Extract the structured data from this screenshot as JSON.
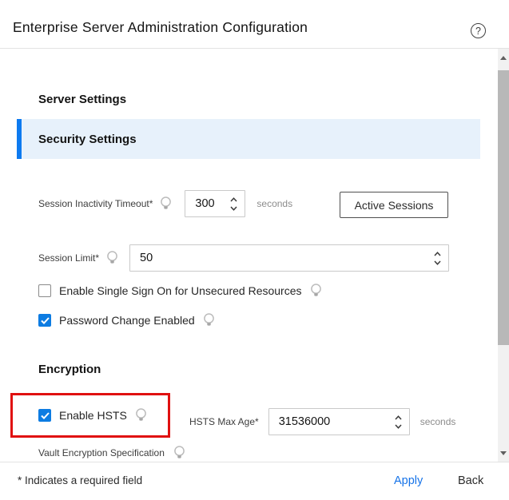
{
  "window": {
    "title": "Enterprise Server Administration Configuration",
    "help_glyph": "?"
  },
  "tabs": [
    {
      "label": "Server Settings",
      "selected": false
    },
    {
      "label": "Security Settings",
      "selected": true
    }
  ],
  "security": {
    "session_timeout": {
      "label": "Session Inactivity Timeout*",
      "value": "300",
      "unit": "seconds"
    },
    "active_sessions": {
      "label": "Active Sessions"
    },
    "session_limit": {
      "label": "Session Limit*",
      "value": "50"
    },
    "sso": {
      "label": "Enable Single Sign On for Unsecured Resources",
      "checked": false
    },
    "password_change": {
      "label": "Password Change Enabled",
      "checked": true
    }
  },
  "encryption": {
    "heading": "Encryption",
    "enable_hsts": {
      "label": "Enable HSTS",
      "checked": true
    },
    "hsts_max_age": {
      "label": "HSTS Max Age*",
      "value": "31536000",
      "unit": "seconds"
    },
    "vault_spec": {
      "label": "Vault Encryption Specification"
    }
  },
  "footer": {
    "required_note": "* Indicates a required field",
    "apply": "Apply",
    "back": "Back"
  },
  "icons": {
    "help": "help-circle-icon",
    "hint": "lightbulb-icon",
    "spinner_up": "chevron-up-icon",
    "spinner_down": "chevron-down-icon"
  },
  "colors": {
    "checkbox_blue": "#0d7ce2",
    "tab_bar_blue": "#0d7af0",
    "tab_highlight_bg": "#e7f1fb",
    "annotation_red": "#e01010",
    "apply_link_blue": "#1673e8"
  }
}
